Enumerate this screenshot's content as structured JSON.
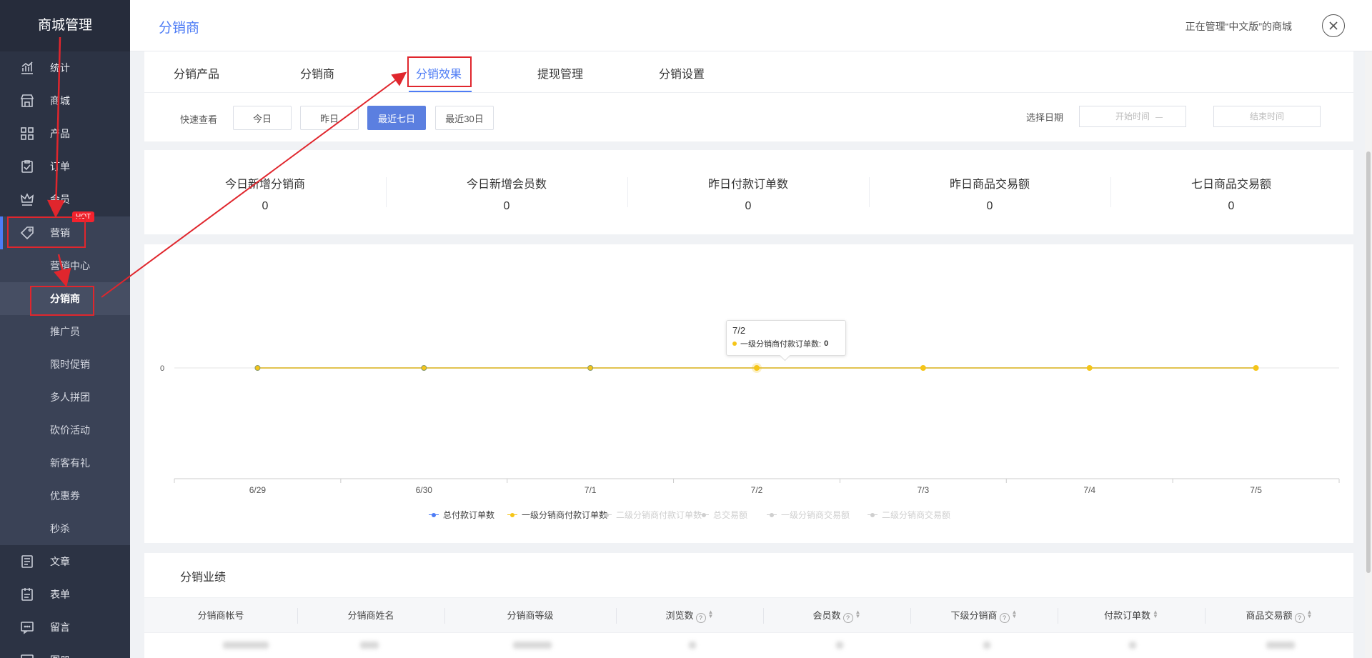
{
  "sidebar": {
    "title": "商城管理",
    "items": [
      {
        "label": "统计",
        "icon": "chart-icon"
      },
      {
        "label": "商城",
        "icon": "store-icon"
      },
      {
        "label": "产品",
        "icon": "grid-icon"
      },
      {
        "label": "订单",
        "icon": "clipboard-icon"
      },
      {
        "label": "会员",
        "icon": "crown-icon"
      },
      {
        "label": "营销",
        "icon": "tag-icon"
      },
      {
        "label": "文章",
        "icon": "article-icon"
      },
      {
        "label": "表单",
        "icon": "form-icon"
      },
      {
        "label": "留言",
        "icon": "message-icon"
      },
      {
        "label": "图册",
        "icon": "album-icon"
      }
    ],
    "hot_badge": "HOT",
    "submenu": [
      "营销中心",
      "分销商",
      "推广员",
      "限时促销",
      "多人拼团",
      "砍价活动",
      "新客有礼",
      "优惠券",
      "秒杀"
    ]
  },
  "header": {
    "title": "分销商",
    "managing": "正在管理“中文版”的商城"
  },
  "tabs": [
    "分销产品",
    "分销商",
    "分销效果",
    "提现管理",
    "分销设置"
  ],
  "filters": {
    "quick_label": "快速查看",
    "buttons": [
      "今日",
      "昨日",
      "最近七日",
      "最近30日"
    ],
    "date_label": "选择日期",
    "start_placeholder": "开始时间",
    "end_placeholder": "结束时间"
  },
  "stats": [
    {
      "label": "今日新增分销商",
      "value": "0"
    },
    {
      "label": "今日新增会员数",
      "value": "0"
    },
    {
      "label": "昨日付款订单数",
      "value": "0"
    },
    {
      "label": "昨日商品交易额",
      "value": "0"
    },
    {
      "label": "七日商品交易额",
      "value": "0"
    }
  ],
  "chart_data": {
    "type": "line",
    "x": [
      "6/29",
      "6/30",
      "7/1",
      "7/2",
      "7/3",
      "7/4",
      "7/5"
    ],
    "y_ticks": [
      "0"
    ],
    "series": [
      {
        "name": "总付款订单数",
        "values": [
          0,
          0,
          0,
          0,
          0,
          0,
          0
        ],
        "color": "#4e7cf5",
        "visible": true
      },
      {
        "name": "一级分销商付款订单数",
        "values": [
          0,
          0,
          0,
          0,
          0,
          0,
          0
        ],
        "color": "#f5c518",
        "visible": true
      },
      {
        "name": "二级分销商付款订单数",
        "values": [
          0,
          0,
          0,
          0,
          0,
          0,
          0
        ],
        "color": "#cccccc",
        "visible": false
      },
      {
        "name": "总交易额",
        "values": [
          0,
          0,
          0,
          0,
          0,
          0,
          0
        ],
        "color": "#cccccc",
        "visible": false
      },
      {
        "name": "一级分销商交易额",
        "values": [
          0,
          0,
          0,
          0,
          0,
          0,
          0
        ],
        "color": "#cccccc",
        "visible": false
      },
      {
        "name": "二级分销商交易额",
        "values": [
          0,
          0,
          0,
          0,
          0,
          0,
          0
        ],
        "color": "#cccccc",
        "visible": false
      }
    ],
    "tooltip": {
      "title": "7/2",
      "label": "一级分销商付款订单数:",
      "value": "0"
    },
    "highlight_index": 3
  },
  "table": {
    "title": "分销业绩",
    "columns": [
      {
        "label": "分销商帐号",
        "help": false,
        "sort": false
      },
      {
        "label": "分销商姓名",
        "help": false,
        "sort": false
      },
      {
        "label": "分销商等级",
        "help": false,
        "sort": false
      },
      {
        "label": "浏览数",
        "help": true,
        "sort": true
      },
      {
        "label": "会员数",
        "help": true,
        "sort": true
      },
      {
        "label": "下级分销商",
        "help": true,
        "sort": true
      },
      {
        "label": "付款订单数",
        "help": false,
        "sort": true
      },
      {
        "label": "商品交易额",
        "help": true,
        "sort": true
      }
    ]
  },
  "colors": {
    "accent": "#4e7cf5",
    "sidebar_bg": "#2c3344",
    "annotation": "#e0262d"
  }
}
